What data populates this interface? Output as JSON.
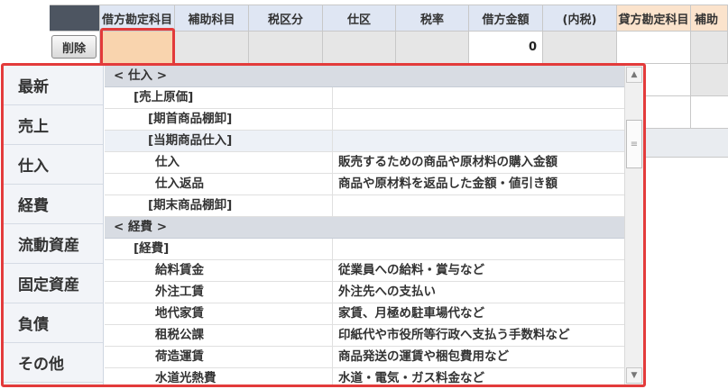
{
  "grid": {
    "headers": [
      "借方勘定科目",
      "補助科目",
      "税区分",
      "仕区",
      "税率",
      "借方金額",
      "(内税)",
      "貸方勘定科目",
      "補助"
    ],
    "delete_label": "削除",
    "debit_amount": "0"
  },
  "categories": [
    "最新",
    "売上",
    "仕入",
    "経費",
    "流動資産",
    "固定資産",
    "負債",
    "その他"
  ],
  "list": [
    {
      "name": "< 仕入 >",
      "desc": "",
      "kind": "group"
    },
    {
      "name": "[売上原価]",
      "desc": "",
      "kind": "sub"
    },
    {
      "name": "[期首商品棚卸]",
      "desc": "",
      "kind": "sub2"
    },
    {
      "name": "[当期商品仕入]",
      "desc": "",
      "kind": "sub2",
      "hl": true
    },
    {
      "name": "仕入",
      "desc": "販売するための商品や原材料の購入金額",
      "kind": "item"
    },
    {
      "name": "仕入返品",
      "desc": "商品や原材料を返品した金額・値引き額",
      "kind": "item"
    },
    {
      "name": "[期末商品棚卸]",
      "desc": "",
      "kind": "sub2"
    },
    {
      "name": "< 経費 >",
      "desc": "",
      "kind": "group"
    },
    {
      "name": "[経費]",
      "desc": "",
      "kind": "sub"
    },
    {
      "name": "給料賃金",
      "desc": "従業員への給料・賞与など",
      "kind": "item"
    },
    {
      "name": "外注工賃",
      "desc": "外注先への支払い",
      "kind": "item"
    },
    {
      "name": "地代家賃",
      "desc": "家賃、月極め駐車場代など",
      "kind": "item"
    },
    {
      "name": "租税公課",
      "desc": "印紙代や市役所等行政へ支払う手数料など",
      "kind": "item"
    },
    {
      "name": "荷造運賃",
      "desc": "商品発送の運賃や梱包費用など",
      "kind": "item"
    },
    {
      "name": "水道光熱費",
      "desc": "水道・電気・ガス料金など",
      "kind": "item"
    }
  ],
  "icons": {
    "scroll_up": "scroll-up-arrow-icon",
    "scroll_down": "scroll-down-arrow-icon",
    "thumb": "scroll-grip-icon"
  }
}
